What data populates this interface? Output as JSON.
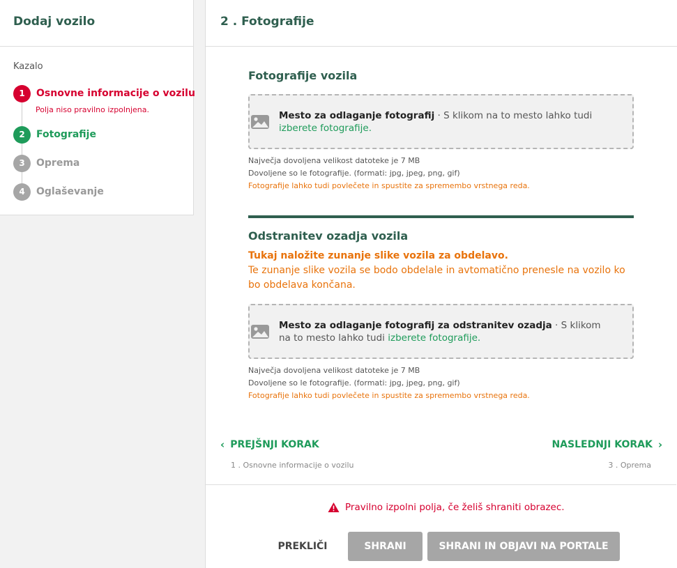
{
  "sidebar": {
    "title": "Dodaj vozilo",
    "toc_label": "Kazalo",
    "steps": [
      {
        "num": "1",
        "label": "Osnovne informacije o vozilu",
        "error": "Polja niso pravilno izpolnjena."
      },
      {
        "num": "2",
        "label": "Fotografije"
      },
      {
        "num": "3",
        "label": "Oprema"
      },
      {
        "num": "4",
        "label": "Oglaševanje"
      }
    ]
  },
  "main": {
    "title": "2 . Fotografije",
    "photos": {
      "title": "Fotografije vozila",
      "dropzone_strong": "Mesto za odlaganje fotografij",
      "dropzone_text": " · S klikom na to mesto lahko tudi ",
      "dropzone_link": "izberete fotografije",
      "dropzone_end": ".",
      "hint_size": "Največja dovoljena velikost datoteke je 7 MB",
      "hint_formats": "Dovoljene so le fotografije. (formati: jpg, jpeg, png, gif)",
      "hint_drag": "Fotografije lahko tudi povlečete in spustite za spremembo vrstnega reda."
    },
    "background": {
      "title": "Odstranitev ozadja vozila",
      "strong_text": "Tukaj naložite zunanje slike vozila za obdelavo.",
      "text": "Te zunanje slike vozila se bodo obdelale in avtomatično prenesle na vozilo ko bo obdelava končana.",
      "dropzone_strong": "Mesto za odlaganje fotografij za odstranitev ozadja",
      "dropzone_text": " · S klikom na to mesto lahko tudi ",
      "dropzone_link": "izberete fotografije",
      "dropzone_end": ".",
      "hint_size": "Največja dovoljena velikost datoteke je 7 MB",
      "hint_formats": "Dovoljene so le fotografije. (formati: jpg, jpeg, png, gif)",
      "hint_drag": "Fotografije lahko tudi povlečete in spustite za spremembo vrstnega reda."
    },
    "nav": {
      "prev_label": "PREJŠNJI KORAK",
      "prev_sub": "1 . Osnovne informacije o vozilu",
      "next_label": "NASLEDNJI KORAK",
      "next_sub": "3 . Oprema"
    },
    "footer": {
      "warning": "Pravilno izpolni polja, če želiš shraniti obrazec.",
      "cancel_label": "PREKLIČI",
      "save_label": "SHRANI",
      "publish_label": "SHRANI IN OBJAVI NA PORTALE"
    }
  },
  "colors": {
    "brand_green": "#2f5f4f",
    "accent_green": "#1e9b5a",
    "error_red": "#d6002f",
    "warning_orange": "#e8730c",
    "disabled_gray": "#a6a6a6"
  }
}
